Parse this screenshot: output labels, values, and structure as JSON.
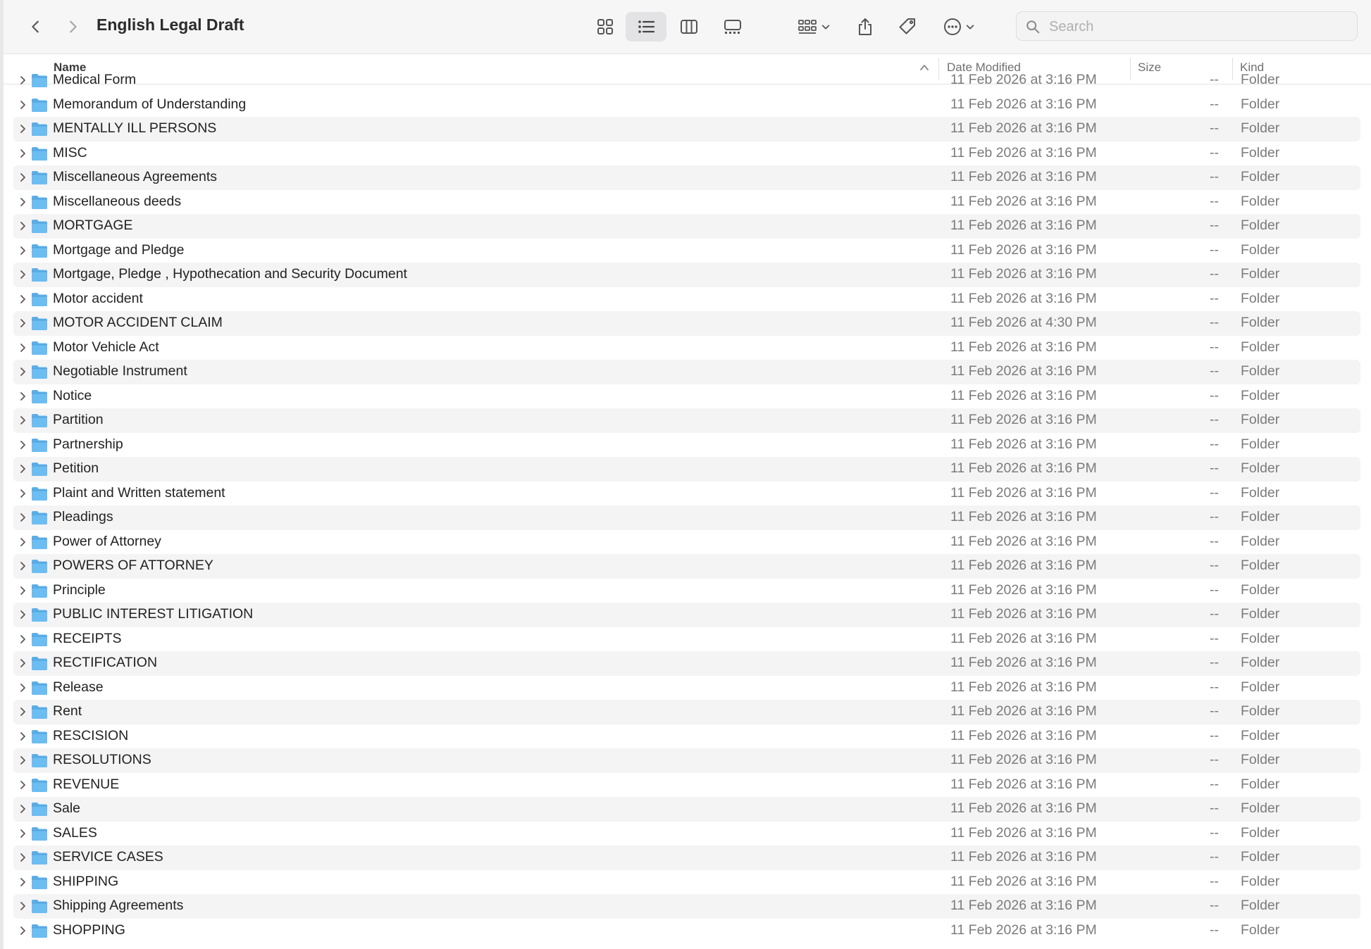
{
  "window": {
    "title": "English Legal Draft",
    "accent_color": "#5e5ce6",
    "folder_color": "#5aaee8"
  },
  "toolbar": {
    "back_icon": "chevron-left-icon",
    "forward_icon": "chevron-right-icon",
    "view_modes": [
      "icon-view",
      "list-view",
      "column-view",
      "gallery-view"
    ],
    "active_view": "list-view",
    "actions": [
      "group-icon",
      "share-icon",
      "tag-icon",
      "more-icon"
    ]
  },
  "search": {
    "placeholder": "Search",
    "value": ""
  },
  "columns": {
    "name": "Name",
    "date": "Date Modified",
    "size": "Size",
    "kind": "Kind"
  },
  "partial_top_row": {
    "name": "Medical Form",
    "date": "11 Feb 2026 at 3:16 PM",
    "size": "--",
    "kind": "Folder"
  },
  "rows": [
    {
      "name": "Memorandum of Understanding",
      "date": "11 Feb 2026 at 3:16 PM",
      "size": "--",
      "kind": "Folder"
    },
    {
      "name": "MENTALLY ILL PERSONS",
      "date": "11 Feb 2026 at 3:16 PM",
      "size": "--",
      "kind": "Folder"
    },
    {
      "name": "MISC",
      "date": "11 Feb 2026 at 3:16 PM",
      "size": "--",
      "kind": "Folder"
    },
    {
      "name": "Miscellaneous Agreements",
      "date": "11 Feb 2026 at 3:16 PM",
      "size": "--",
      "kind": "Folder"
    },
    {
      "name": "Miscellaneous deeds",
      "date": "11 Feb 2026 at 3:16 PM",
      "size": "--",
      "kind": "Folder"
    },
    {
      "name": "MORTGAGE",
      "date": "11 Feb 2026 at 3:16 PM",
      "size": "--",
      "kind": "Folder"
    },
    {
      "name": "Mortgage and Pledge",
      "date": "11 Feb 2026 at 3:16 PM",
      "size": "--",
      "kind": "Folder"
    },
    {
      "name": "Mortgage, Pledge , Hypothecation and Security Document",
      "date": "11 Feb 2026 at 3:16 PM",
      "size": "--",
      "kind": "Folder"
    },
    {
      "name": "Motor accident",
      "date": "11 Feb 2026 at 3:16 PM",
      "size": "--",
      "kind": "Folder"
    },
    {
      "name": "MOTOR ACCIDENT CLAIM",
      "date": "11 Feb 2026 at 4:30 PM",
      "size": "--",
      "kind": "Folder"
    },
    {
      "name": "Motor Vehicle Act",
      "date": "11 Feb 2026 at 3:16 PM",
      "size": "--",
      "kind": "Folder"
    },
    {
      "name": "Negotiable Instrument",
      "date": "11 Feb 2026 at 3:16 PM",
      "size": "--",
      "kind": "Folder"
    },
    {
      "name": "Notice",
      "date": "11 Feb 2026 at 3:16 PM",
      "size": "--",
      "kind": "Folder"
    },
    {
      "name": "Partition",
      "date": "11 Feb 2026 at 3:16 PM",
      "size": "--",
      "kind": "Folder"
    },
    {
      "name": "Partnership",
      "date": "11 Feb 2026 at 3:16 PM",
      "size": "--",
      "kind": "Folder"
    },
    {
      "name": "Petition",
      "date": "11 Feb 2026 at 3:16 PM",
      "size": "--",
      "kind": "Folder"
    },
    {
      "name": "Plaint and Written statement",
      "date": "11 Feb 2026 at 3:16 PM",
      "size": "--",
      "kind": "Folder"
    },
    {
      "name": "Pleadings",
      "date": "11 Feb 2026 at 3:16 PM",
      "size": "--",
      "kind": "Folder"
    },
    {
      "name": "Power of Attorney",
      "date": "11 Feb 2026 at 3:16 PM",
      "size": "--",
      "kind": "Folder"
    },
    {
      "name": "POWERS OF ATTORNEY",
      "date": "11 Feb 2026 at 3:16 PM",
      "size": "--",
      "kind": "Folder"
    },
    {
      "name": "Principle",
      "date": "11 Feb 2026 at 3:16 PM",
      "size": "--",
      "kind": "Folder"
    },
    {
      "name": "PUBLIC INTEREST LITIGATION",
      "date": "11 Feb 2026 at 3:16 PM",
      "size": "--",
      "kind": "Folder"
    },
    {
      "name": "RECEIPTS",
      "date": "11 Feb 2026 at 3:16 PM",
      "size": "--",
      "kind": "Folder"
    },
    {
      "name": "RECTIFICATION",
      "date": "11 Feb 2026 at 3:16 PM",
      "size": "--",
      "kind": "Folder"
    },
    {
      "name": "Release",
      "date": "11 Feb 2026 at 3:16 PM",
      "size": "--",
      "kind": "Folder"
    },
    {
      "name": "Rent",
      "date": "11 Feb 2026 at 3:16 PM",
      "size": "--",
      "kind": "Folder"
    },
    {
      "name": "RESCISION",
      "date": "11 Feb 2026 at 3:16 PM",
      "size": "--",
      "kind": "Folder"
    },
    {
      "name": "RESOLUTIONS",
      "date": "11 Feb 2026 at 3:16 PM",
      "size": "--",
      "kind": "Folder"
    },
    {
      "name": "REVENUE",
      "date": "11 Feb 2026 at 3:16 PM",
      "size": "--",
      "kind": "Folder"
    },
    {
      "name": "Sale",
      "date": "11 Feb 2026 at 3:16 PM",
      "size": "--",
      "kind": "Folder"
    },
    {
      "name": "SALES",
      "date": "11 Feb 2026 at 3:16 PM",
      "size": "--",
      "kind": "Folder"
    },
    {
      "name": "SERVICE CASES",
      "date": "11 Feb 2026 at 3:16 PM",
      "size": "--",
      "kind": "Folder"
    },
    {
      "name": "SHIPPING",
      "date": "11 Feb 2026 at 3:16 PM",
      "size": "--",
      "kind": "Folder"
    },
    {
      "name": "Shipping Agreements",
      "date": "11 Feb 2026 at 3:16 PM",
      "size": "--",
      "kind": "Folder"
    },
    {
      "name": "SHOPPING",
      "date": "11 Feb 2026 at 3:16 PM",
      "size": "--",
      "kind": "Folder"
    }
  ]
}
